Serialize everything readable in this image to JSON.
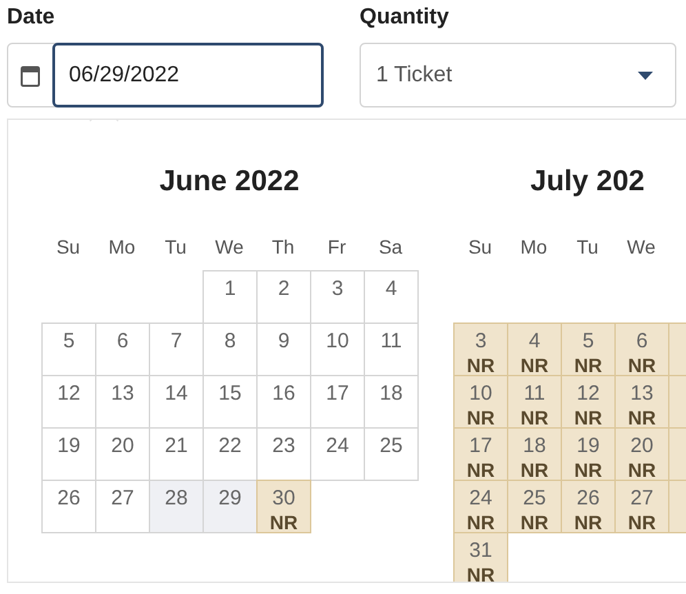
{
  "date_field": {
    "label": "Date",
    "value": "06/29/2022",
    "focused": true
  },
  "quantity_field": {
    "label": "Quantity",
    "value": "1 Ticket"
  },
  "calendar": {
    "months": [
      {
        "title": "June 2022",
        "weekdays": [
          "Su",
          "Mo",
          "Tu",
          "We",
          "Th",
          "Fr",
          "Sa"
        ],
        "weeks": [
          [
            {
              "kind": "blank"
            },
            {
              "kind": "blank"
            },
            {
              "kind": "blank"
            },
            {
              "day": "1",
              "kind": "open"
            },
            {
              "day": "2",
              "kind": "open"
            },
            {
              "day": "3",
              "kind": "open"
            },
            {
              "day": "4",
              "kind": "open"
            }
          ],
          [
            {
              "day": "5",
              "kind": "open"
            },
            {
              "day": "6",
              "kind": "open"
            },
            {
              "day": "7",
              "kind": "open"
            },
            {
              "day": "8",
              "kind": "open"
            },
            {
              "day": "9",
              "kind": "open"
            },
            {
              "day": "10",
              "kind": "open"
            },
            {
              "day": "11",
              "kind": "open"
            }
          ],
          [
            {
              "day": "12",
              "kind": "open"
            },
            {
              "day": "13",
              "kind": "open"
            },
            {
              "day": "14",
              "kind": "open"
            },
            {
              "day": "15",
              "kind": "open"
            },
            {
              "day": "16",
              "kind": "open"
            },
            {
              "day": "17",
              "kind": "open"
            },
            {
              "day": "18",
              "kind": "open"
            }
          ],
          [
            {
              "day": "19",
              "kind": "open"
            },
            {
              "day": "20",
              "kind": "open"
            },
            {
              "day": "21",
              "kind": "open"
            },
            {
              "day": "22",
              "kind": "open"
            },
            {
              "day": "23",
              "kind": "open"
            },
            {
              "day": "24",
              "kind": "open"
            },
            {
              "day": "25",
              "kind": "open"
            }
          ],
          [
            {
              "day": "26",
              "kind": "open"
            },
            {
              "day": "27",
              "kind": "open"
            },
            {
              "day": "28",
              "kind": "shaded"
            },
            {
              "day": "29",
              "kind": "shaded"
            },
            {
              "day": "30",
              "kind": "nr",
              "note": "NR"
            },
            {
              "kind": "blank"
            },
            {
              "kind": "blank"
            }
          ]
        ]
      },
      {
        "title": "July 202",
        "weekdays": [
          "Su",
          "Mo",
          "Tu",
          "We"
        ],
        "weeks": [
          [
            {
              "kind": "blank"
            },
            {
              "kind": "blank"
            },
            {
              "kind": "blank"
            },
            {
              "kind": "blank"
            },
            {
              "kind": "blank"
            }
          ],
          [
            {
              "day": "3",
              "kind": "nr",
              "note": "NR"
            },
            {
              "day": "4",
              "kind": "nr",
              "note": "NR"
            },
            {
              "day": "5",
              "kind": "nr",
              "note": "NR"
            },
            {
              "day": "6",
              "kind": "nr",
              "note": "NR"
            },
            {
              "kind": "cut"
            }
          ],
          [
            {
              "day": "10",
              "kind": "nr",
              "note": "NR"
            },
            {
              "day": "11",
              "kind": "nr",
              "note": "NR"
            },
            {
              "day": "12",
              "kind": "nr",
              "note": "NR"
            },
            {
              "day": "13",
              "kind": "nr",
              "note": "NR"
            },
            {
              "kind": "cut"
            }
          ],
          [
            {
              "day": "17",
              "kind": "nr",
              "note": "NR"
            },
            {
              "day": "18",
              "kind": "nr",
              "note": "NR"
            },
            {
              "day": "19",
              "kind": "nr",
              "note": "NR"
            },
            {
              "day": "20",
              "kind": "nr",
              "note": "NR"
            },
            {
              "kind": "cut"
            }
          ],
          [
            {
              "day": "24",
              "kind": "nr",
              "note": "NR"
            },
            {
              "day": "25",
              "kind": "nr",
              "note": "NR"
            },
            {
              "day": "26",
              "kind": "nr",
              "note": "NR"
            },
            {
              "day": "27",
              "kind": "nr",
              "note": "NR"
            },
            {
              "kind": "cut"
            }
          ],
          [
            {
              "day": "31",
              "kind": "nr",
              "note": "NR"
            },
            {
              "kind": "blank"
            },
            {
              "kind": "blank"
            },
            {
              "kind": "blank"
            },
            {
              "kind": "blank"
            }
          ]
        ]
      }
    ]
  }
}
